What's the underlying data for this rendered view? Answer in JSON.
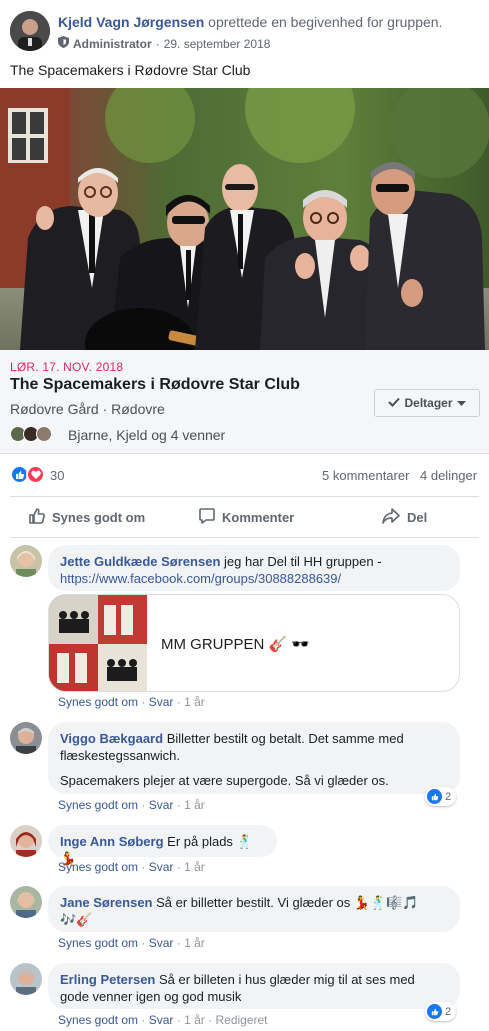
{
  "post": {
    "author": "Kjeld Vagn Jørgensen",
    "action": "oprettede en begivenhed for gruppen.",
    "role": "Administrator",
    "separator": "·",
    "date": "29. september 2018",
    "text": "The Spacemakers i Rødovre Star Club"
  },
  "event": {
    "date": "LØR. 17. NOV. 2018",
    "title": "The Spacemakers i Rødovre Star Club",
    "location": "Rødovre Gård · Rødovre",
    "rsvp_label": "Deltager",
    "going_text": "Bjarne, Kjeld og 4 venner"
  },
  "reactions": {
    "count": "30",
    "comments": "5 kommentarer",
    "shares": "4 delinger"
  },
  "actions": {
    "like": "Synes godt om",
    "comment": "Kommenter",
    "share": "Del"
  },
  "comments": [
    {
      "name": "Jette Guldkæde Sørensen",
      "text": "jeg har Del til HH gruppen -",
      "link": "https://www.facebook.com/groups/30888288639/",
      "card_title": "MM GRUPPEN 🎸 🕶️",
      "like": "Synes godt om",
      "reply": "Svar",
      "time": "1 år"
    },
    {
      "name": "Viggo Bækgaard",
      "text": "Billetter bestilt og betalt. Det samme med",
      "text2": "flæskestegssanwich.",
      "text3": "Spacemakers plejer at være supergode. Så vi glæder os.",
      "like": "Synes godt om",
      "reply": "Svar",
      "time": "1 år",
      "likes": "2"
    },
    {
      "name": "Inge Ann Søberg",
      "text": "Er på plads 🕺💃",
      "like": "Synes godt om",
      "reply": "Svar",
      "time": "1 år"
    },
    {
      "name": "Jane Sørensen",
      "text": "Så er billetter bestilt. Vi glæder os 💃🕺🎼🎵",
      "text2": "🎶🎸",
      "like": "Synes godt om",
      "reply": "Svar",
      "time": "1 år"
    },
    {
      "name": "Erling Petersen",
      "text": "Så er billeten i hus glæder mig til at ses med",
      "text2": "gode venner igen og god musik",
      "like": "Synes godt om",
      "reply": "Svar",
      "time": "1 år",
      "edited": "Redigeret",
      "likes": "2"
    }
  ],
  "colors": {
    "link": "#385898",
    "event_date": "#e0245e",
    "like_blue": "#1877f2",
    "love_red": "#f33e58"
  }
}
